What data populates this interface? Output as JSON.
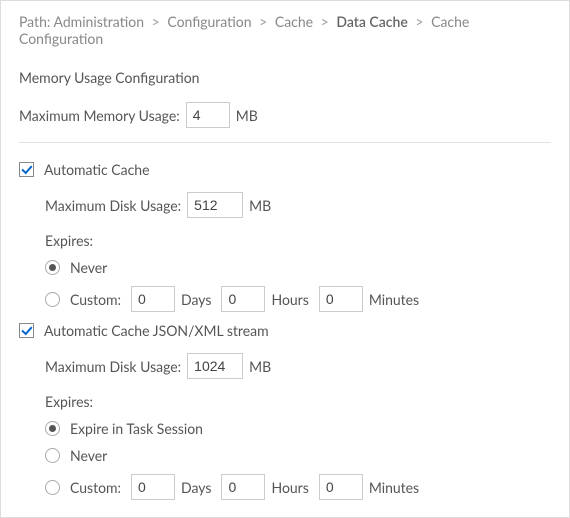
{
  "breadcrumb": {
    "prefix": "Path:",
    "items": [
      "Administration",
      "Configuration",
      "Cache",
      "Data Cache",
      "Cache Configuration"
    ],
    "currentIndex": 3
  },
  "memory": {
    "title": "Memory Usage Configuration",
    "maxLabel": "Maximum Memory Usage:",
    "maxValue": "4",
    "unit": "MB"
  },
  "autoCache": {
    "label": "Automatic Cache",
    "diskLabel": "Maximum Disk Usage:",
    "diskValue": "512",
    "diskUnit": "MB",
    "expiresLabel": "Expires:",
    "options": {
      "never": "Never",
      "custom": "Custom:"
    },
    "custom": {
      "days": "0",
      "daysLabel": "Days",
      "hours": "0",
      "hoursLabel": "Hours",
      "minutes": "0",
      "minutesLabel": "Minutes"
    }
  },
  "autoCacheJson": {
    "label": "Automatic Cache JSON/XML stream",
    "diskLabel": "Maximum Disk Usage:",
    "diskValue": "1024",
    "diskUnit": "MB",
    "expiresLabel": "Expires:",
    "options": {
      "taskSession": "Expire in Task Session",
      "never": "Never",
      "custom": "Custom:"
    },
    "custom": {
      "days": "0",
      "daysLabel": "Days",
      "hours": "0",
      "hoursLabel": "Hours",
      "minutes": "0",
      "minutesLabel": "Minutes"
    }
  }
}
